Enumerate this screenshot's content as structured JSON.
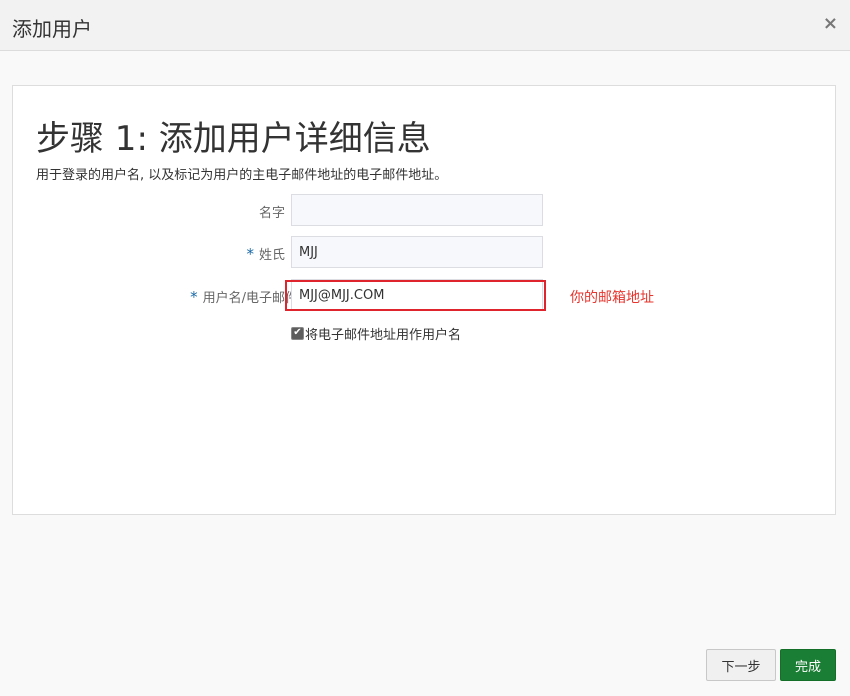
{
  "dialog": {
    "title": "添加用户",
    "close_label": "×"
  },
  "step": {
    "title": "步骤 1: 添加用户详细信息",
    "description": "用于登录的用户名, 以及标记为用户的主电子邮件地址的电子邮件地址。"
  },
  "form": {
    "first_name": {
      "label": "名字",
      "value": "",
      "required": false
    },
    "last_name": {
      "label": "姓氏",
      "value": "MJJ",
      "required": true
    },
    "username": {
      "label": "用户名/电子邮件",
      "value": "MJJ@MJJ.COM",
      "required": true
    },
    "required_marker": "*",
    "use_email_as_username": {
      "label": "将电子邮件地址用作用户名",
      "checked": true
    }
  },
  "annotation": {
    "text": "你的邮箱地址",
    "color": "#e8342d"
  },
  "buttons": {
    "next_label": "下一步",
    "finish_label": "完成"
  },
  "colors": {
    "primary_button": "#1a7e34",
    "required_marker": "#1a6aa8",
    "highlight": "#e0242d"
  }
}
